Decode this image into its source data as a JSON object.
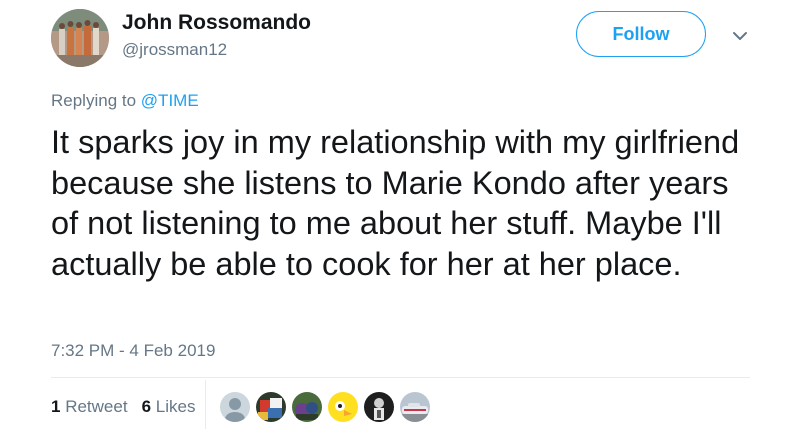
{
  "user": {
    "display_name": "John Rossomando",
    "handle": "@jrossman12"
  },
  "actions": {
    "follow_label": "Follow"
  },
  "reply": {
    "prefix": "Replying to",
    "mention": "@TIME"
  },
  "tweet": {
    "text": "It sparks joy in my relationship with my girlfriend because she listens to Marie Kondo after years of not listening to me about her stuff. Maybe I'll actually be able to cook for her at her place.",
    "timestamp": "7:32 PM - 4 Feb 2019"
  },
  "stats": {
    "retweets_count": "1",
    "retweets_label": "Retweet",
    "likes_count": "6",
    "likes_label": "Likes"
  },
  "colors": {
    "accent": "#1da1f2",
    "secondary_text": "#657786",
    "primary_text": "#14171a",
    "divider": "#e6ecf0"
  },
  "icons": {
    "menu": "chevron-down-icon"
  }
}
